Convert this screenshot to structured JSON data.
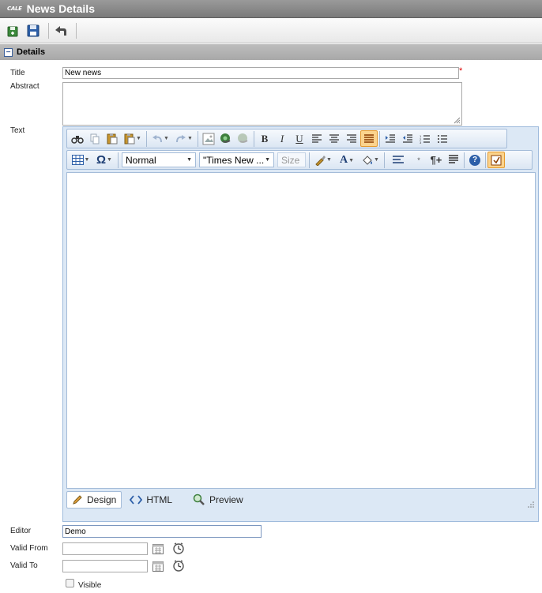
{
  "window": {
    "logo_text": "CALE",
    "title": "News Details"
  },
  "toolbar": {
    "buttons": [
      "save-and-new",
      "save",
      "back"
    ]
  },
  "section": {
    "label": "Details",
    "collapse_glyph": "−"
  },
  "form": {
    "title_label": "Title",
    "title_value": "New news",
    "required_mark": "*",
    "abstract_label": "Abstract",
    "abstract_value": "",
    "text_label": "Text",
    "editor_label": "Editor",
    "editor_value": "Demo",
    "valid_from_label": "Valid From",
    "valid_from_value": "",
    "valid_to_label": "Valid To",
    "valid_to_value": "",
    "visible_label": "Visible",
    "visible_checked": false
  },
  "rich_editor": {
    "paragraph_style": "Normal",
    "font_name": "\"Times New ...",
    "font_size_placeholder": "Size",
    "modes": [
      "Design",
      "HTML",
      "Preview"
    ],
    "active_mode": "Design",
    "bold": "B",
    "italic": "I",
    "underline": "U",
    "omega": "Ω",
    "font_color": "A",
    "help": "?",
    "paragraph_mark": "¶+"
  }
}
